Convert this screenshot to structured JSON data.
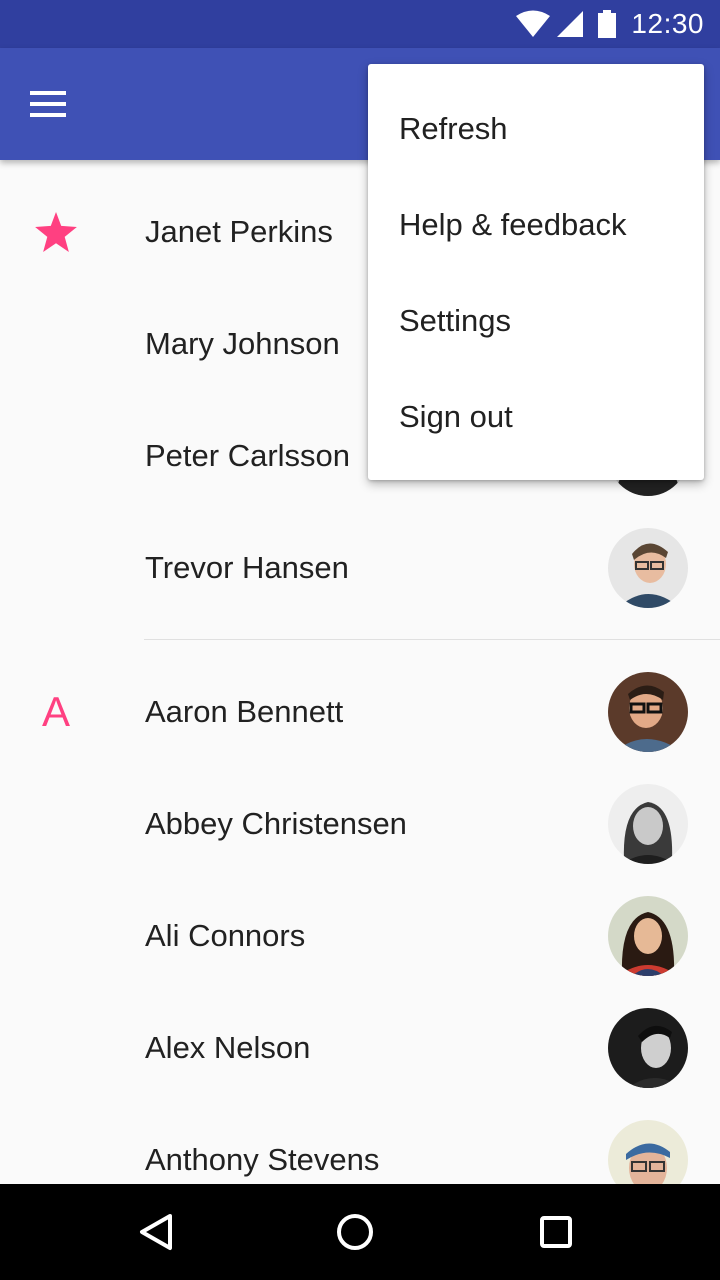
{
  "status_bar": {
    "time": "12:30",
    "icons": [
      "wifi-icon",
      "signal-icon",
      "battery-icon"
    ]
  },
  "app_bar": {
    "color": "#3f51b5",
    "menu_icon": "hamburger-menu-icon"
  },
  "overflow_menu": {
    "items": [
      {
        "label": "Refresh"
      },
      {
        "label": "Help & feedback"
      },
      {
        "label": "Settings"
      },
      {
        "label": "Sign out"
      }
    ]
  },
  "contacts": {
    "favorites_icon": "star-icon",
    "favorites": [
      {
        "name": "Janet Perkins"
      },
      {
        "name": "Mary Johnson"
      },
      {
        "name": "Peter Carlsson"
      },
      {
        "name": "Trevor Hansen"
      }
    ],
    "section_letter": "A",
    "section_a": [
      {
        "name": "Aaron Bennett"
      },
      {
        "name": "Abbey Christensen"
      },
      {
        "name": "Ali Connors"
      },
      {
        "name": "Alex Nelson"
      },
      {
        "name": "Anthony Stevens"
      }
    ]
  },
  "accent_color": "#ff4081",
  "nav_bar": {
    "buttons": [
      "back-icon",
      "home-icon",
      "recents-icon"
    ]
  }
}
